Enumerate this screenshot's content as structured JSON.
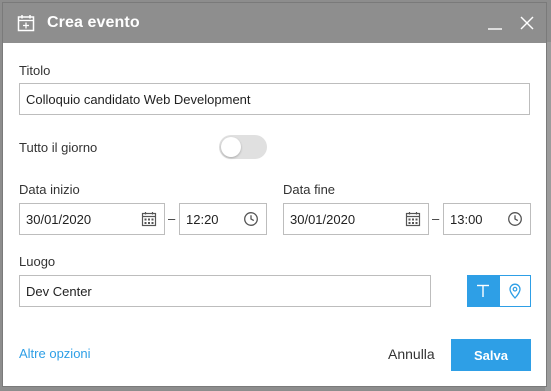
{
  "dialog": {
    "title": "Crea evento",
    "title_icon": "calendar-add-icon",
    "minimize_icon": "minimize-icon",
    "close_icon": "close-icon"
  },
  "form": {
    "title_label": "Titolo",
    "title_value": "Colloquio candidato Web Development",
    "all_day_label": "Tutto il giorno",
    "all_day_on": false,
    "start_label": "Data inizio",
    "start_date": "30/01/2020",
    "start_time": "12:20",
    "end_label": "Data fine",
    "end_date": "30/01/2020",
    "end_time": "13:00",
    "range_separator": "–",
    "location_label": "Luogo",
    "location_value": "Dev Center",
    "location_mode_text_icon": "text-type-icon",
    "location_mode_map_icon": "map-pin-icon"
  },
  "footer": {
    "more_options": "Altre opzioni",
    "cancel": "Annulla",
    "save": "Salva"
  },
  "colors": {
    "accent": "#2e9fe6",
    "titlebar": "#8e8e8e"
  }
}
